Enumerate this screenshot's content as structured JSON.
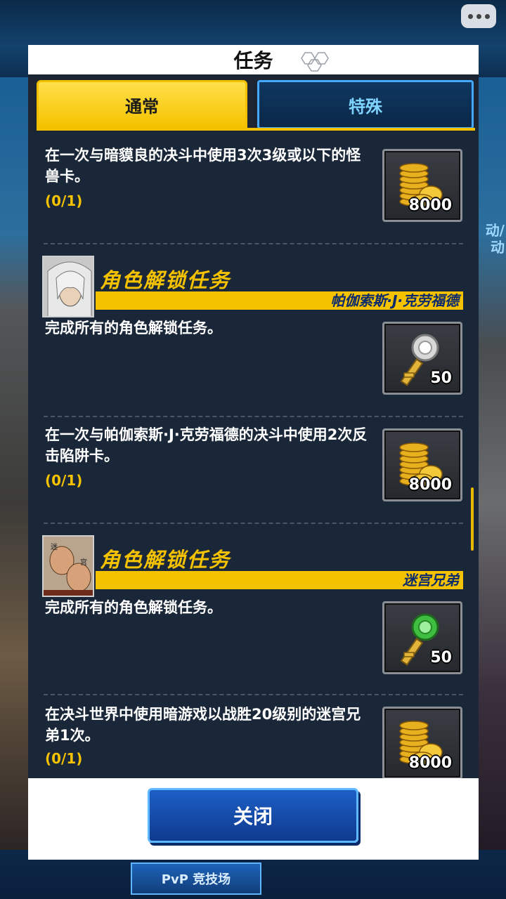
{
  "header": {
    "title": "任务"
  },
  "tabs": [
    {
      "label": "通常",
      "active": true
    },
    {
      "label": "特殊",
      "active": false
    }
  ],
  "side_text": "动/\n动",
  "bottom_nav": {
    "pvp_label": "PvP 竞技场"
  },
  "missions": [
    {
      "text": "在一次与暗貘良的决斗中使用3次3级或以下的怪兽卡。",
      "progress": "(0/1)",
      "reward_icon": "gold-coins-icon",
      "reward_amount": "8000"
    },
    {
      "unlock_title": "角色解锁任务",
      "character": "帕伽索斯·J·克劳福德",
      "text": "完成所有的角色解锁任务。",
      "reward_icon": "silver-key-icon",
      "reward_amount": "50"
    },
    {
      "text": "在一次与帕伽索斯·J·克劳福德的决斗中使用2次反击陷阱卡。",
      "progress": "(0/1)",
      "reward_icon": "gold-coins-icon",
      "reward_amount": "8000"
    },
    {
      "unlock_title": "角色解锁任务",
      "character": "迷宫兄弟",
      "text": "完成所有的角色解锁任务。",
      "reward_icon": "green-key-icon",
      "reward_amount": "50"
    },
    {
      "text": "在决斗世界中使用暗游戏以战胜20级别的迷宫兄弟1次。",
      "progress": "(0/1)",
      "reward_icon": "gold-coins-icon",
      "reward_amount": "8000"
    }
  ],
  "close_button": {
    "label": "关闭"
  },
  "colors": {
    "accent_yellow": "#f5c200",
    "list_bg": "#1a2738",
    "tab_blue": "#42a9ff",
    "button_blue": "#1d5fc6"
  }
}
